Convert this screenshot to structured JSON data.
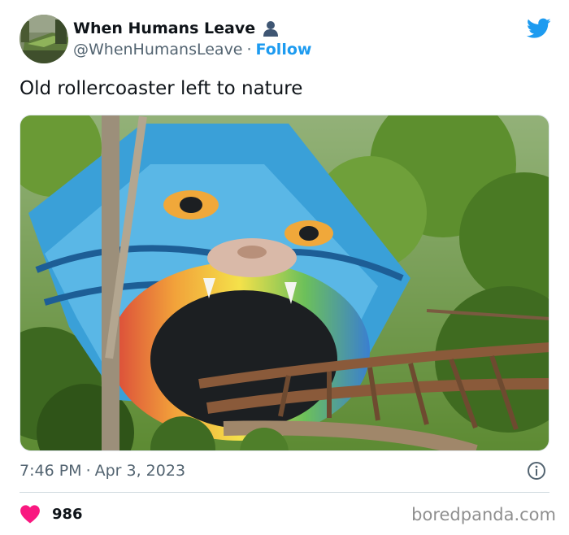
{
  "header": {
    "display_name": "When Humans Leave",
    "handle": "@WhenHumansLeave",
    "separator": "·",
    "follow_label": "Follow",
    "verified_icon": "person-icon",
    "logo_icon": "twitter-bird-icon"
  },
  "tweet": {
    "text": "Old rollercoaster left to nature"
  },
  "meta": {
    "time": "7:46 PM",
    "separator": "·",
    "date": "Apr 3, 2023",
    "info_icon": "info-icon"
  },
  "engagement": {
    "like_icon": "heart-icon",
    "like_count": "986"
  },
  "watermark": "boredpanda.com",
  "colors": {
    "accent": "#1d9bf0",
    "like": "#f91880",
    "text_primary": "#0f1419",
    "text_secondary": "#536471"
  }
}
